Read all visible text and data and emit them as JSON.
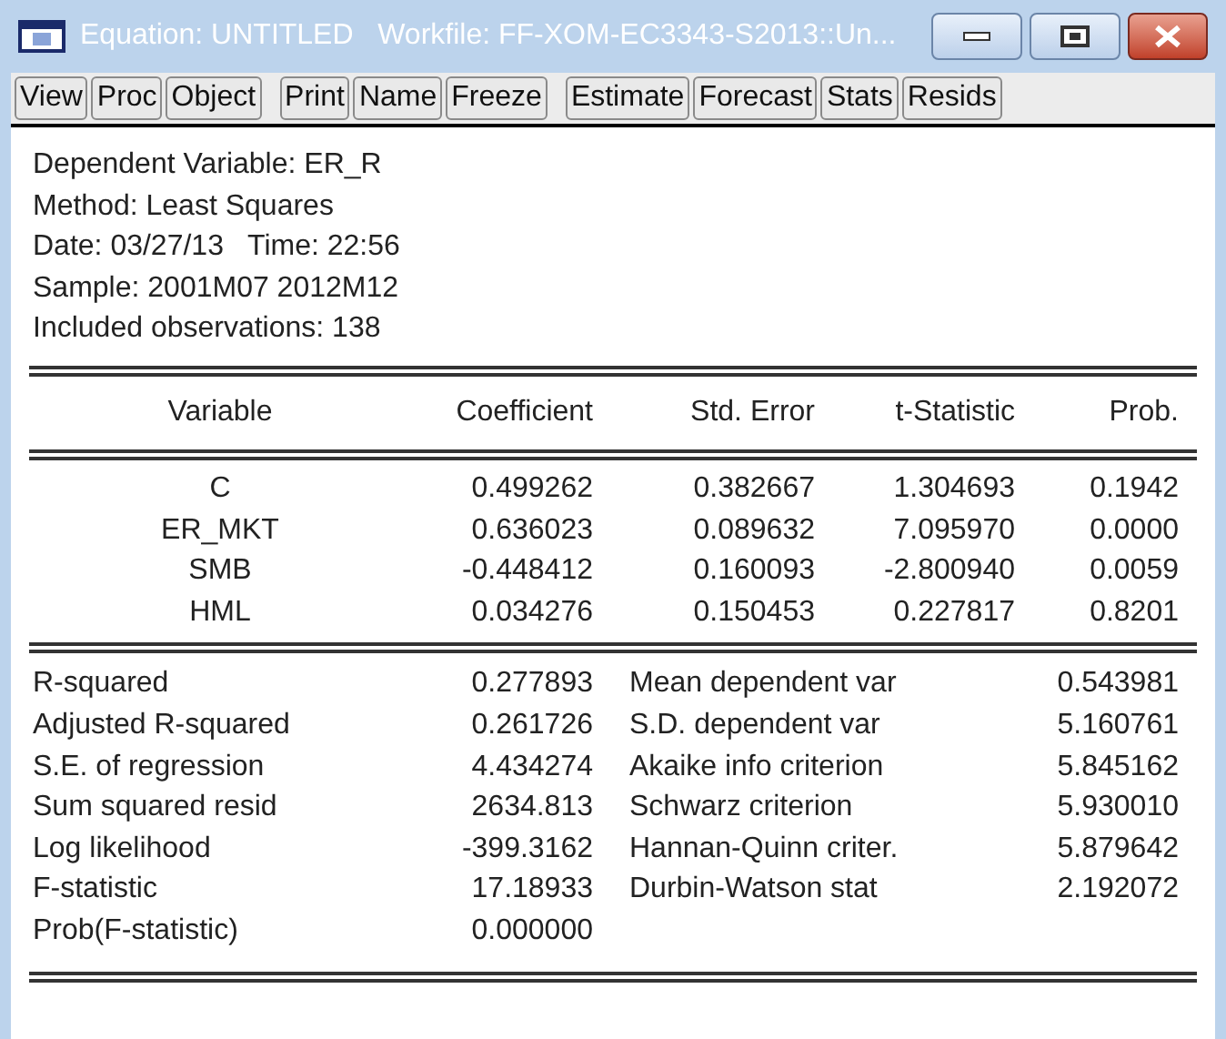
{
  "window": {
    "title": "Equation: UNTITLED   Workfile: FF-XOM-EC3343-S2013::Un..."
  },
  "toolbar": [
    [
      "View",
      "Proc",
      "Object"
    ],
    [
      "Print",
      "Name",
      "Freeze"
    ],
    [
      "Estimate",
      "Forecast",
      "Stats",
      "Resids"
    ]
  ],
  "header_lines": [
    "Dependent Variable: ER_R",
    "Method: Least Squares",
    "Date: 03/27/13   Time: 22:56",
    "Sample: 2001M07 2012M12",
    "Included observations: 138"
  ],
  "table": {
    "columns": [
      "Variable",
      "Coefficient",
      "Std. Error",
      "t-Statistic",
      "Prob."
    ],
    "rows": [
      [
        "C",
        "0.499262",
        "0.382667",
        "1.304693",
        "0.1942"
      ],
      [
        "ER_MKT",
        "0.636023",
        "0.089632",
        "7.095970",
        "0.0000"
      ],
      [
        "SMB",
        "-0.448412",
        "0.160093",
        "-2.800940",
        "0.0059"
      ],
      [
        "HML",
        "0.034276",
        "0.150453",
        "0.227817",
        "0.8201"
      ]
    ]
  },
  "statistics": [
    [
      "R-squared",
      "0.277893",
      "Mean dependent var",
      "0.543981"
    ],
    [
      "Adjusted R-squared",
      "0.261726",
      "S.D. dependent var",
      "5.160761"
    ],
    [
      "S.E. of regression",
      "4.434274",
      "Akaike info criterion",
      "5.845162"
    ],
    [
      "Sum squared resid",
      "2634.813",
      "Schwarz criterion",
      "5.930010"
    ],
    [
      "Log likelihood",
      "-399.3162",
      "Hannan-Quinn criter.",
      "5.879642"
    ],
    [
      "F-statistic",
      "17.18933",
      "Durbin-Watson stat",
      "2.192072"
    ],
    [
      "Prob(F-statistic)",
      "0.000000"
    ]
  ]
}
